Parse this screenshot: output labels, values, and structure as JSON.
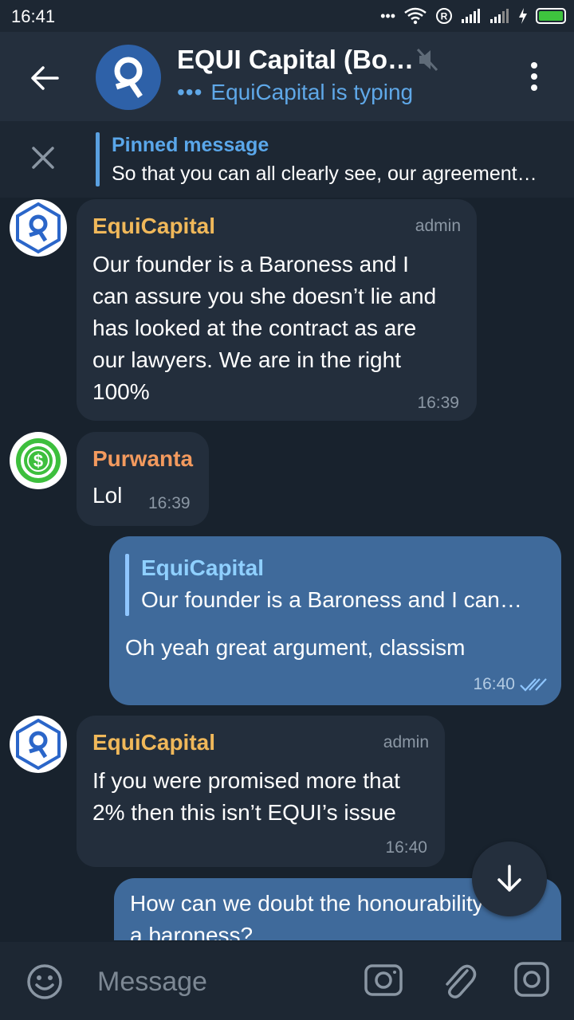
{
  "status_bar": {
    "time": "16:41",
    "dots": "•••"
  },
  "header": {
    "title": "EQUI Capital (Bo…",
    "typing_dots": "•••",
    "subtitle": "EquiCapital is typing"
  },
  "pinned": {
    "title": "Pinned message",
    "text": "So that you can all clearly see, our agreement…"
  },
  "messages": [
    {
      "sender": "EquiCapital",
      "role": "admin",
      "lines": [
        "Our founder is a Baroness and I",
        "can assure you she doesn’t lie and",
        "has looked at the contract as are",
        "our lawyers. We are in the right",
        "100%"
      ],
      "time": "16:39"
    },
    {
      "sender": "Purwanta",
      "text": "Lol",
      "time": "16:39"
    },
    {
      "reply_name": "EquiCapital",
      "reply_text": "Our founder is a Baroness and I can…",
      "text": "Oh yeah great argument, classism",
      "time": "16:40"
    },
    {
      "sender": "EquiCapital",
      "role": "admin",
      "lines": [
        "If you were promised more that",
        "2% then this isn’t EQUI’s issue"
      ],
      "time": "16:40"
    },
    {
      "lines": [
        "How can we doubt the honourability of",
        "a baroness?"
      ]
    }
  ],
  "composer": {
    "placeholder": "Message"
  },
  "colors": {
    "accent": "#5aa7ea",
    "sender_equi": "#f0b85a",
    "sender_purwanta": "#f39a5e",
    "bubble_out": "#3f6a9b",
    "bubble_in": "#232e3c"
  }
}
